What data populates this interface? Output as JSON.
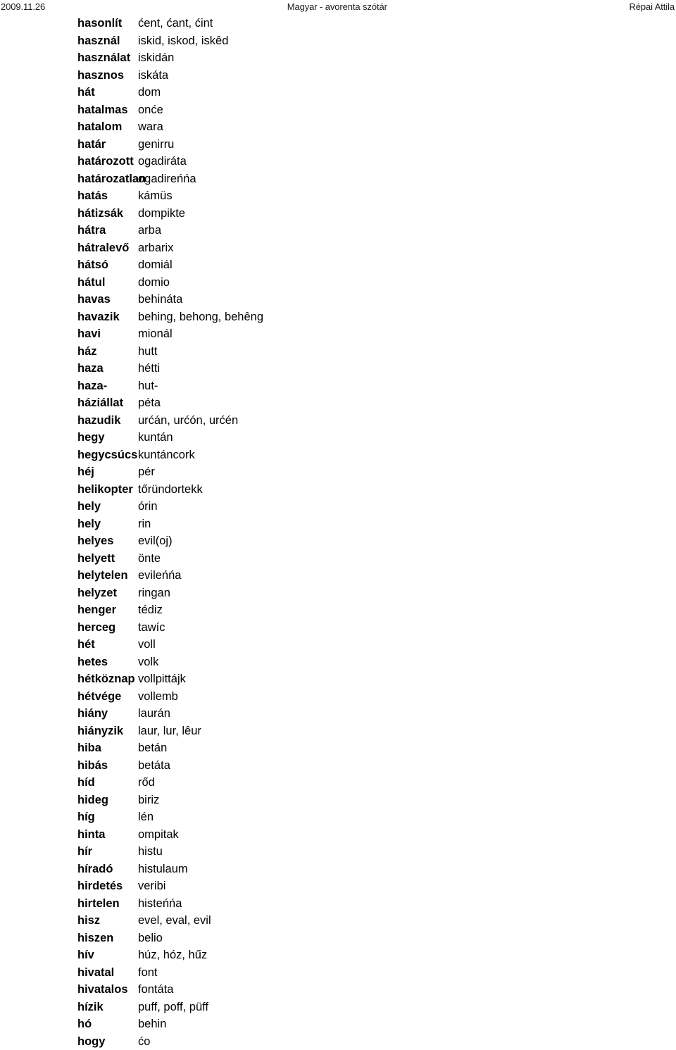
{
  "header": {
    "date": "2009.11.26",
    "title": "Magyar - avorenta szótár",
    "author": "Répai Attila"
  },
  "dictionary": {
    "entries": [
      {
        "term": "hasonlít",
        "definition": "ćent, ćant, ćint"
      },
      {
        "term": "használ",
        "definition": "iskid, iskod, iskêd"
      },
      {
        "term": "használat",
        "definition": "iskidán"
      },
      {
        "term": "hasznos",
        "definition": "iskáta"
      },
      {
        "term": "hát",
        "definition": "dom"
      },
      {
        "term": "hatalmas",
        "definition": "onće"
      },
      {
        "term": "hatalom",
        "definition": "wara"
      },
      {
        "term": "határ",
        "definition": "genirru"
      },
      {
        "term": "határozott",
        "definition": "ogadiráta"
      },
      {
        "term": "határozatlan",
        "definition": "ogadireńńa"
      },
      {
        "term": "hatás",
        "definition": "kámüs"
      },
      {
        "term": "hátizsák",
        "definition": "dompikte"
      },
      {
        "term": "hátra",
        "definition": "arba"
      },
      {
        "term": "hátralevő",
        "definition": "arbarix"
      },
      {
        "term": "hátsó",
        "definition": "domiál"
      },
      {
        "term": "hátul",
        "definition": "domio"
      },
      {
        "term": "havas",
        "definition": "behináta"
      },
      {
        "term": "havazik",
        "definition": "behing, behong, behêng"
      },
      {
        "term": "havi",
        "definition": "mionál"
      },
      {
        "term": "ház",
        "definition": "hutt"
      },
      {
        "term": "haza",
        "definition": "hétti"
      },
      {
        "term": "haza-",
        "definition": "hut-"
      },
      {
        "term": "háziállat",
        "definition": "péta"
      },
      {
        "term": "hazudik",
        "definition": "urćán, urćón, urćén"
      },
      {
        "term": "hegy",
        "definition": "kuntán"
      },
      {
        "term": "hegycsúcs",
        "definition": "kuntáncork"
      },
      {
        "term": "héj",
        "definition": "pér"
      },
      {
        "term": "helikopter",
        "definition": "tőründortekk"
      },
      {
        "term": "hely",
        "definition": "órin"
      },
      {
        "term": "hely",
        "definition": "rin"
      },
      {
        "term": "helyes",
        "definition": "evil(oj)"
      },
      {
        "term": "helyett",
        "definition": "önte"
      },
      {
        "term": "helytelen",
        "definition": "evileńńa"
      },
      {
        "term": "helyzet",
        "definition": "ringan"
      },
      {
        "term": "henger",
        "definition": "tédiz"
      },
      {
        "term": "herceg",
        "definition": "tawíc"
      },
      {
        "term": "hét",
        "definition": "voll"
      },
      {
        "term": "hetes",
        "definition": "volk"
      },
      {
        "term": "hétköznap",
        "definition": "vollpittájk"
      },
      {
        "term": "hétvége",
        "definition": "vollemb"
      },
      {
        "term": "hiány",
        "definition": "laurán"
      },
      {
        "term": "hiányzik",
        "definition": "laur, lur, lêur"
      },
      {
        "term": "hiba",
        "definition": "betán"
      },
      {
        "term": "hibás",
        "definition": "betáta"
      },
      {
        "term": "híd",
        "definition": "rőd"
      },
      {
        "term": "hideg",
        "definition": "biriz"
      },
      {
        "term": "híg",
        "definition": "lén"
      },
      {
        "term": "hinta",
        "definition": "ompitak"
      },
      {
        "term": "hír",
        "definition": "histu"
      },
      {
        "term": "híradó",
        "definition": "histulaum"
      },
      {
        "term": "hirdetés",
        "definition": "veribi"
      },
      {
        "term": "hirtelen",
        "definition": "histeńńa"
      },
      {
        "term": "hisz",
        "definition": "evel, eval, evil"
      },
      {
        "term": "hiszen",
        "definition": "belio"
      },
      {
        "term": "hív",
        "definition": "húz, hóz, hűz"
      },
      {
        "term": "hivatal",
        "definition": "font"
      },
      {
        "term": "hivatalos",
        "definition": "fontáta"
      },
      {
        "term": "hízik",
        "definition": "puff, poff, püff"
      },
      {
        "term": "hó",
        "definition": "behin"
      },
      {
        "term": "hogy",
        "definition": "ćo"
      }
    ]
  }
}
